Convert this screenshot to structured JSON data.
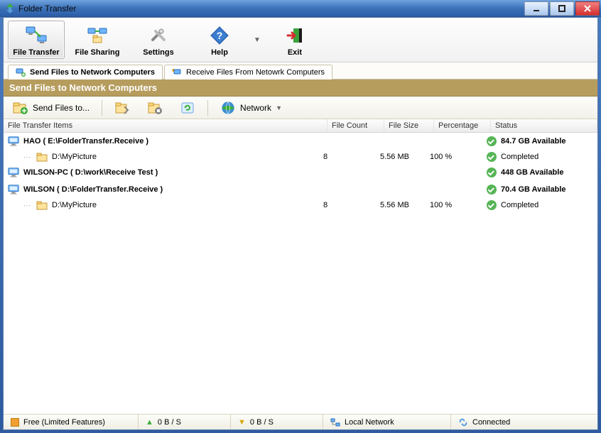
{
  "title": "Folder Transfer",
  "toolbar": {
    "file_transfer": "File Transfer",
    "file_sharing": "File Sharing",
    "settings": "Settings",
    "help": "Help",
    "exit": "Exit"
  },
  "tabs": {
    "send": "Send Files to Network Computers",
    "receive": "Receive Files From Netowrk Computers"
  },
  "banner": "Send Files to Network Computers",
  "smalltoolbar": {
    "send_files_to": "Send Files to...",
    "network": "Network"
  },
  "columns": {
    "item": "File Transfer Items",
    "count": "File Count",
    "size": "File Size",
    "percentage": "Percentage",
    "status": "Status"
  },
  "rows": [
    {
      "kind": "parent",
      "monitor": true,
      "label": "HAO ( E:\\FolderTransfer.Receive )",
      "status": "84.7 GB Available"
    },
    {
      "kind": "child",
      "folder": true,
      "label": "D:\\MyPicture",
      "count": "8",
      "size": "5.56 MB",
      "perc": "100 %",
      "status": "Completed"
    },
    {
      "kind": "parent",
      "monitor": true,
      "label": "WILSON-PC ( D:\\work\\Receive Test )",
      "status": "448 GB Available"
    },
    {
      "kind": "parent",
      "monitor": true,
      "label": "WILSON ( D:\\FolderTransfer.Receive )",
      "status": "70.4 GB Available"
    },
    {
      "kind": "child",
      "folder": true,
      "label": "D:\\MyPicture",
      "count": "8",
      "size": "5.56 MB",
      "perc": "100 %",
      "status": "Completed"
    }
  ],
  "status": {
    "license": "Free (Limited Features)",
    "up": "0 B / S",
    "down": "0 B / S",
    "network": "Local Network",
    "connected": "Connected"
  }
}
